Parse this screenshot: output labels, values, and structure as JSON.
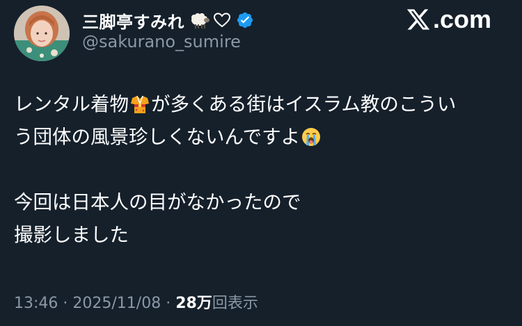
{
  "user": {
    "display_name": "三脚亭すみれ",
    "handle": "@sakurano_sumire",
    "badge_emoji": "sheep-emoji",
    "heart": "♡",
    "verified": true
  },
  "brand": {
    "x_letter": "𝕏",
    "domain": ".com"
  },
  "tweet": {
    "line1_a": "レンタル着物",
    "line1_b": "が多くある街はイスラム教のこうい",
    "line2_a": "う団体の風景珍しくないんですよ",
    "line3": "今回は日本人の目がなかったので",
    "line4": "撮影しました"
  },
  "meta": {
    "time": "13:46",
    "separator": "·",
    "date": "2025/11/08",
    "views_count": "28万",
    "views_label": "回表示"
  },
  "colors": {
    "background": "#15202b",
    "text_primary": "#ffffff",
    "text_secondary": "#8b98a5",
    "verified_blue": "#1d9bf0"
  }
}
